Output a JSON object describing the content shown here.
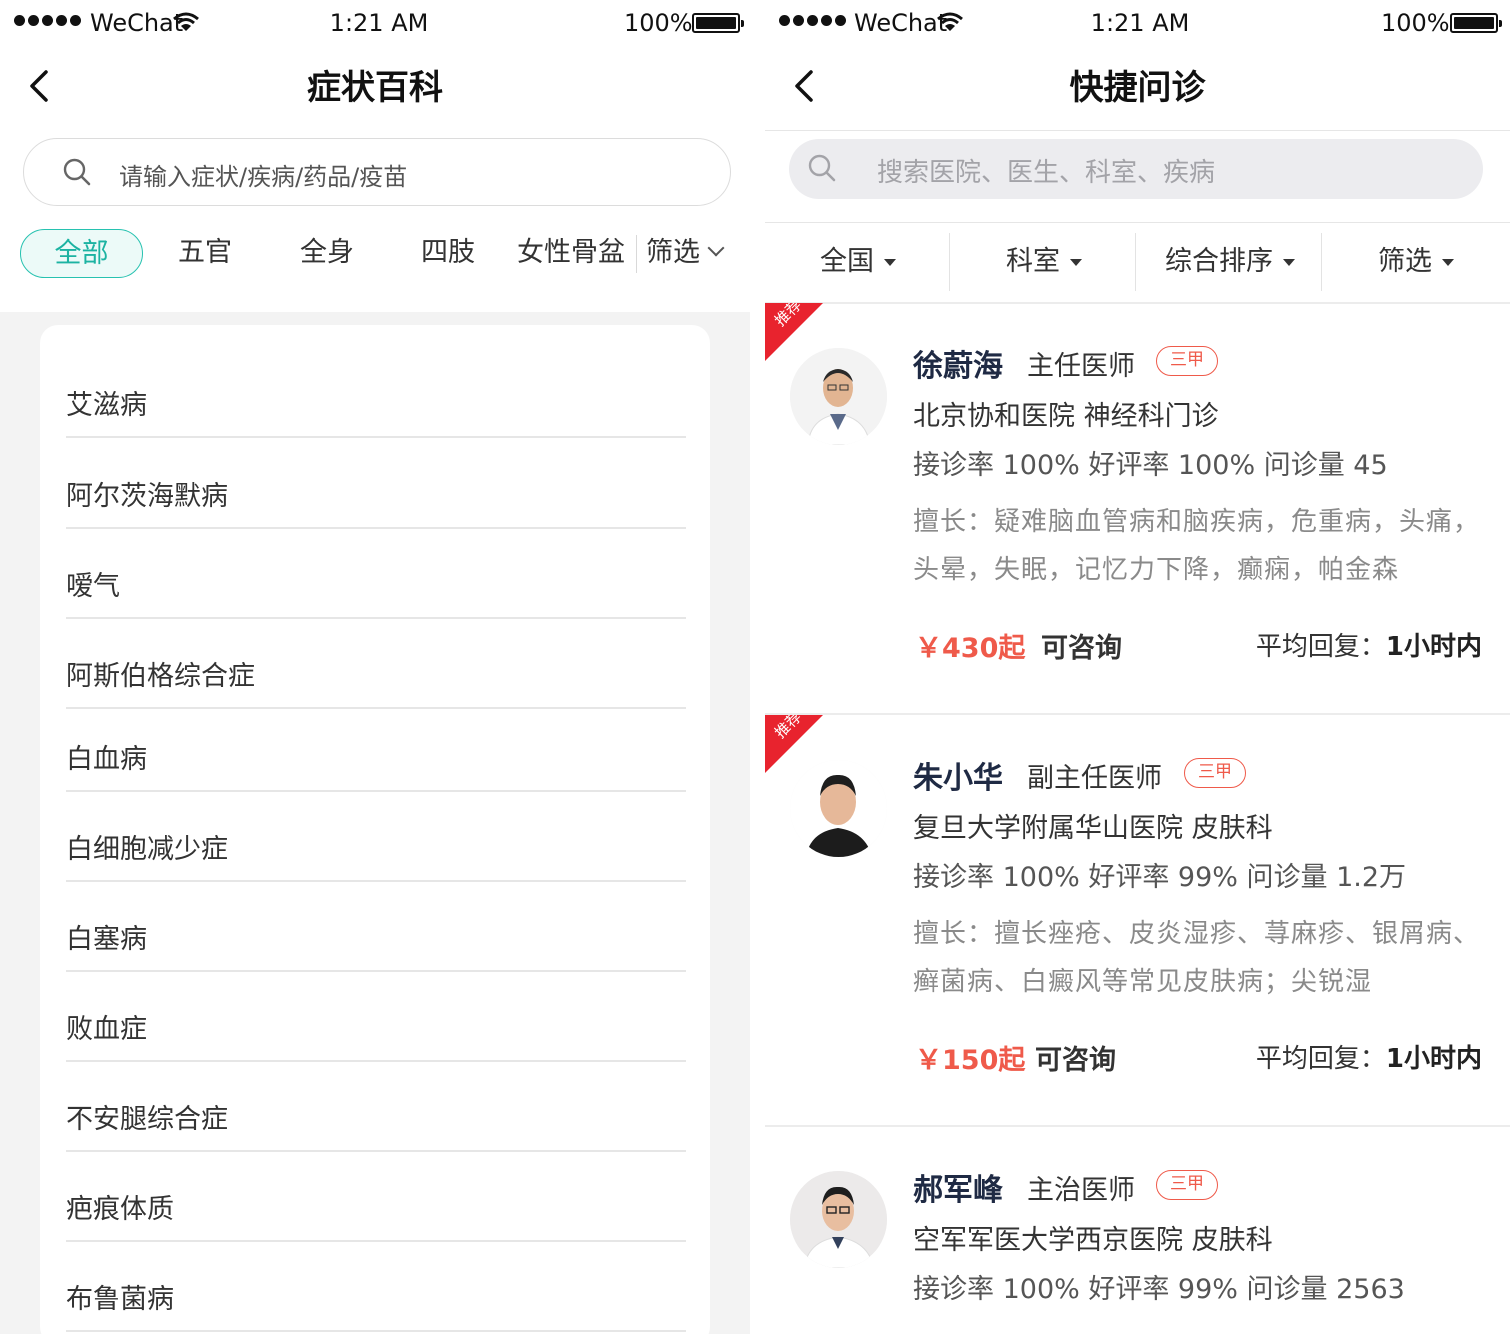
{
  "left": {
    "status": {
      "carrier": "WeChat",
      "time": "1:21 AM",
      "battery": "100%"
    },
    "title": "症状百科",
    "search_placeholder": "请输入症状/疾病/药品/疫苗",
    "tabs": [
      "全部",
      "五官",
      "全身",
      "四肢",
      "女性骨盆"
    ],
    "filter_label": "筛选",
    "diseases": [
      "艾滋病",
      "阿尔茨海默病",
      "嗳气",
      "阿斯伯格综合症",
      "白血病",
      "白细胞减少症",
      "白塞病",
      "败血症",
      "不安腿综合症",
      "疤痕体质",
      "布鲁菌病"
    ],
    "accent_color": "#1cb3a2"
  },
  "right": {
    "status": {
      "carrier": "WeChat",
      "time": "1:21 AM",
      "battery": "100%"
    },
    "title": "快捷问诊",
    "search_placeholder": "搜索医院、医生、科室、疾病",
    "filters": [
      "全国",
      "科室",
      "综合排序",
      "筛选"
    ],
    "recommend_label": "推荐",
    "doctors": [
      {
        "name": "徐蔚海",
        "title": "主任医师",
        "level": "三甲",
        "hospital": "北京协和医院  神经科门诊",
        "stats": "接诊率 100%  好评率 100%  问诊量 45",
        "desc": "擅长：疑难脑血管病和脑疾病，危重病，头痛，头晕，失眠，记忆力下降，癫痫，帕金森",
        "price": "￥430起",
        "consult": "可咨询",
        "reply_label": "平均回复：",
        "reply_value": "1小时内",
        "recommended": true
      },
      {
        "name": "朱小华",
        "title": "副主任医师",
        "level": "三甲",
        "hospital": "复旦大学附属华山医院  皮肤科",
        "stats": "接诊率 100%  好评率 99%  问诊量 1.2万",
        "desc": "擅长：擅长痤疮、皮炎湿疹、荨麻疹、银屑病、癣菌病、白癜风等常见皮肤病；尖锐湿",
        "price": "￥150起",
        "consult": "可咨询",
        "reply_label": "平均回复：",
        "reply_value": "1小时内",
        "recommended": true
      },
      {
        "name": "郝军峰",
        "title": "主治医师",
        "level": "三甲",
        "hospital": "空军军医大学西京医院  皮肤科",
        "stats": "接诊率 100%  好评率 99%  问诊量 2563",
        "recommended": false
      }
    ],
    "accent_color": "#ef5a4a"
  }
}
